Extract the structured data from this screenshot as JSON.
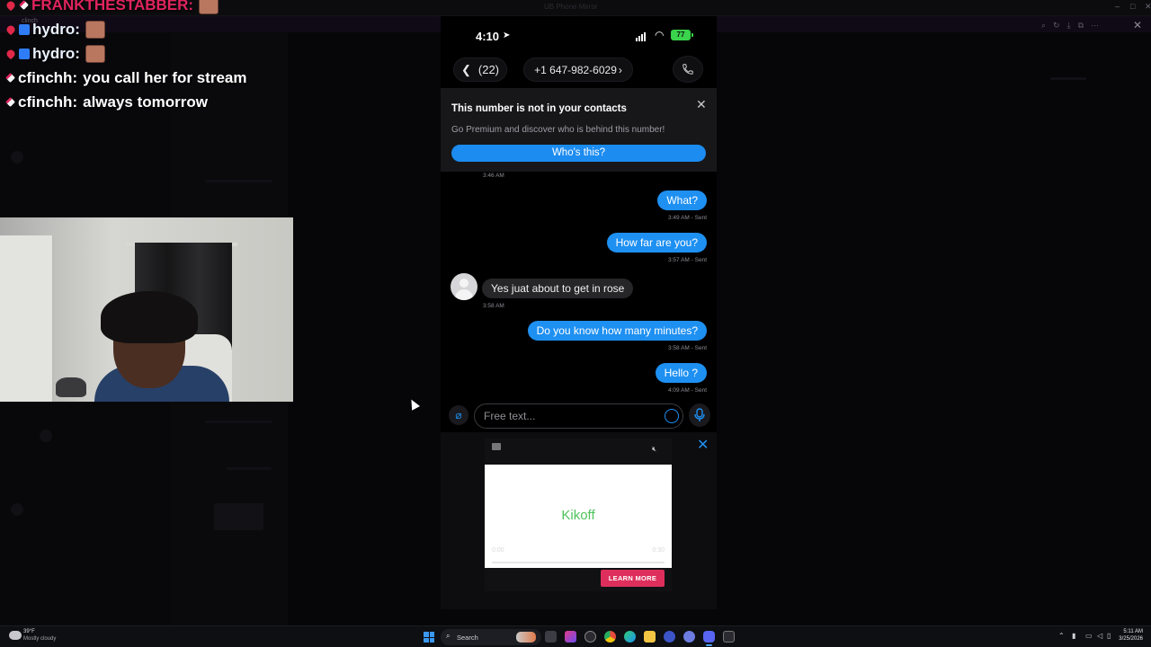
{
  "stream_chat": [
    {
      "user": "FRANKTHESTABBER",
      "text": "",
      "emote": true,
      "badges": [
        "heart",
        "pen"
      ],
      "name_color": "#e0245e"
    },
    {
      "user": "hydro",
      "text": "",
      "emote": true,
      "badges": [
        "heart",
        "sub"
      ],
      "name_color": "#eaf3ff"
    },
    {
      "user": "hydro",
      "text": "",
      "emote": true,
      "badges": [
        "heart",
        "sub"
      ],
      "name_color": "#eaf3ff"
    },
    {
      "user": "cfinchh",
      "text": "you call her for stream",
      "emote": false,
      "badges": [
        "pen"
      ],
      "name_color": "#ffffff"
    },
    {
      "user": "cfinchh",
      "text": "always tomorrow",
      "emote": false,
      "badges": [
        "pen"
      ],
      "name_color": "#ffffff"
    }
  ],
  "chat_suffix": ":",
  "bg_window": {
    "title": "UB Phone Mirror",
    "small_tag": "clinch"
  },
  "phone": {
    "status": {
      "time": "4:10",
      "battery": "77"
    },
    "nav": {
      "back_count": "(22)",
      "phone_number": "+1 647-982-6029"
    },
    "banner": {
      "title": "This number is not in your contacts",
      "subtitle": "Go Premium and discover who is behind this number!",
      "button": "Who's this?"
    },
    "messages": [
      {
        "dir": "in-ts",
        "time": "3:46 AM"
      },
      {
        "dir": "out",
        "text": "What?",
        "time": "3:49 AM - Sent"
      },
      {
        "dir": "out",
        "text": "How far are you?",
        "time": "3:57 AM - Sent"
      },
      {
        "dir": "in",
        "text": "Yes juat about to get in rose",
        "time": "3:58 AM"
      },
      {
        "dir": "out",
        "text": "Do you know how many minutes?",
        "time": "3:58 AM - Sent"
      },
      {
        "dir": "out",
        "text": "Hello ?",
        "time": "4:09 AM - Sent"
      }
    ],
    "composer": {
      "placeholder": "Free text..."
    },
    "ad": {
      "brand": "Kikoff",
      "time_start": "0:00",
      "time_end": "0:30",
      "cta": "LEARN MORE"
    }
  },
  "taskbar": {
    "weather_temp": "39°F",
    "weather_desc": "Mostly cloudy",
    "search_label": "Search",
    "clock_time": "5:11 AM",
    "clock_date": "3/25/2026"
  },
  "colors": {
    "accent_blue": "#1e90f2",
    "cta_pink": "#de2f5c",
    "brand_green": "#4fc35c",
    "name_red": "#e0245e"
  }
}
